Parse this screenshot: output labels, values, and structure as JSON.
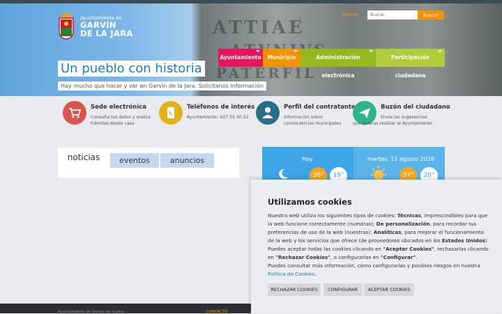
{
  "header": {
    "logo_subtitle": "Ayuntamiento de",
    "logo_name_line1": "GARVÍN",
    "logo_name_line2": "DE LA JARA",
    "search_link": "Buscar",
    "search_placeholder": "Buscar...",
    "search_button": "Buscar"
  },
  "nav": [
    {
      "label": "Ayuntamiento",
      "color": "#e5165a"
    },
    {
      "label": "Municipio",
      "color": "#f39200"
    },
    {
      "label": "Administración electrónica",
      "color": "#93b91e"
    },
    {
      "label": "Participación ciudadana",
      "color": "#b2cb3b"
    }
  ],
  "hero": {
    "title": "Un pueblo con historia",
    "subtitle": "Hay mucho que hacer y ver en Garvín de la Jara. Solicitanos información"
  },
  "services": [
    {
      "title": "Sede electrónica",
      "desc": "Consulta tus datos y realiza trámites desde casa",
      "color": "#d9534f",
      "icon": "cart-icon"
    },
    {
      "title": "Teléfonos de interés",
      "desc": "Ayuntamiento: 927 55 30 52",
      "color": "#e2b21a",
      "icon": "phone-icon"
    },
    {
      "title": "Perfil del contratante",
      "desc": "Información sobre convocatorias municipales",
      "color": "#2a6d88",
      "icon": "person-icon"
    },
    {
      "title": "Buzón del ciudadano",
      "desc": "Envía las sugerencias que quieras realizar al Ayuntamiento",
      "color": "#2fb38a",
      "icon": "mail-icon"
    }
  ],
  "tabs": [
    "noticias",
    "eventos",
    "anuncios"
  ],
  "weather": {
    "today_label": "Hoy",
    "today_max": "36°",
    "today_min": "19°",
    "date_label": "martes, 11 agosto 2026",
    "next_max": "37°",
    "next_min": "20°"
  },
  "footer": {
    "left": "Ayuntamiento de Garvín de la Jara",
    "contact": "CONTACTO"
  },
  "cookies": {
    "title": "Utilizamos cookies",
    "p1_a": "Nuestra web utiliza los siguientes tipos de cookies: ",
    "p1_b": "Técnicas",
    "p1_c": ", imprescindibles para que la web funcione correctamente (nuestras); ",
    "p1_d": "De personalización",
    "p1_e": ", para recordar tus preferencias de uso de la web (nuestras); ",
    "p1_f": "Analíticas",
    "p1_g": ", para mejorar el funcionamiento de la web y los servicios que ofrece (de proveedores ubicados en los ",
    "p1_h": "Estados Unidos",
    "p1_i": ").",
    "p2_a": "Puedes aceptar todas las cookies clicando en ",
    "p2_b": "\"Aceptar Cookies\"",
    "p2_c": ", rechazarlas clicando en ",
    "p2_d": "\"Rechazar Cookies\"",
    "p2_e": ", o configurarlas en ",
    "p2_f": "\"Configurar\"",
    "p2_g": ".",
    "p3": "Puedes consultar más información, cómo configurarlas y posibles riesgos en nuestra",
    "policy_link": "Política de Cookies",
    "p3_end": ".",
    "reject": "RECHAZAR COOKIES",
    "configure": "CONFIGURAR",
    "accept": "ACEPTAR COOKIES"
  }
}
